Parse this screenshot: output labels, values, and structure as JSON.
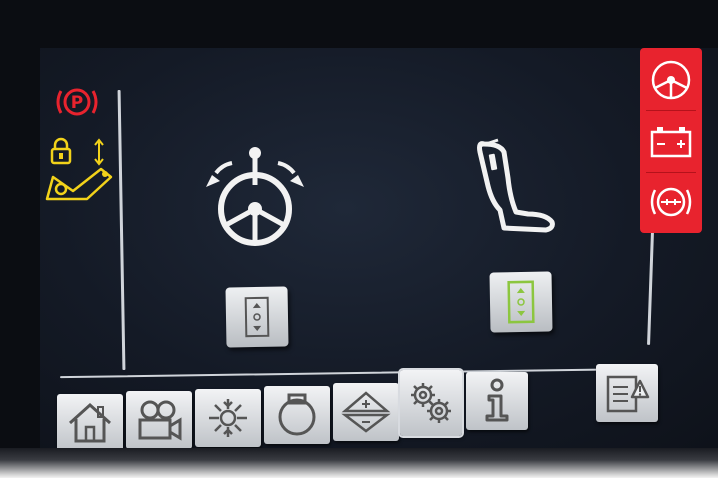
{
  "colors": {
    "warning_red": "#e8232e",
    "caution_yellow": "#f2d21a",
    "active_green": "#8cc63f",
    "icon_white": "#f2f2f2"
  },
  "status_column": {
    "icons": [
      "parking-brake-icon",
      "lock-icon",
      "vertical-arrow-icon",
      "lift-arm-icon"
    ]
  },
  "controls": [
    {
      "name": "steering-control",
      "icon": "steering-wheel-icon",
      "button_icon": "adjust-stepper-icon",
      "active": false
    },
    {
      "name": "seat-control",
      "icon": "seat-icon",
      "button_icon": "adjust-stepper-icon",
      "active": true
    }
  ],
  "alerts": [
    {
      "icon": "steering-warning-icon"
    },
    {
      "icon": "battery-warning-icon"
    },
    {
      "icon": "brake-warning-icon"
    }
  ],
  "tabs": [
    {
      "icon": "home-icon"
    },
    {
      "icon": "camera-icon"
    },
    {
      "icon": "climate-icon"
    },
    {
      "icon": "engine-icon"
    },
    {
      "icon": "adjust-icon"
    },
    {
      "icon": "settings-icon",
      "selected": true
    },
    {
      "icon": "info-icon"
    },
    {
      "icon": "warning-log-icon"
    }
  ]
}
